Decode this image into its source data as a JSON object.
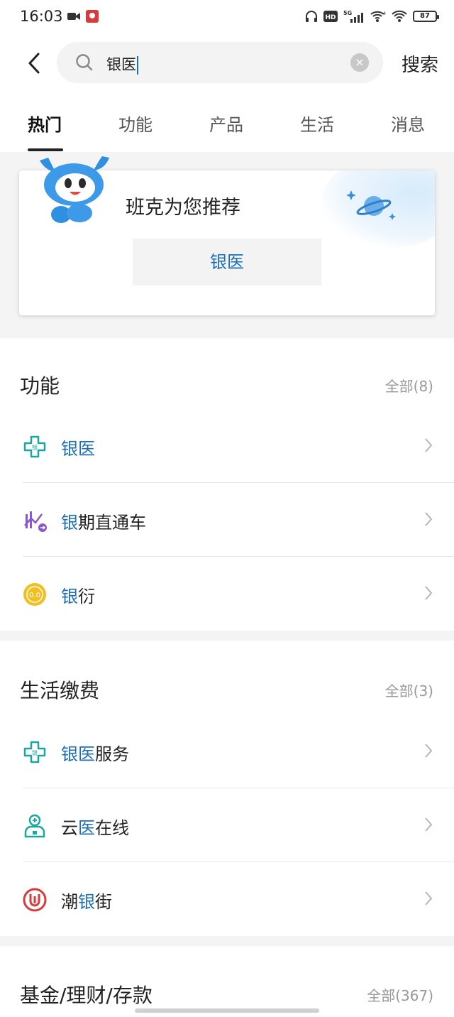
{
  "status_bar": {
    "time": "16:03",
    "battery": "87",
    "network": "5G"
  },
  "search": {
    "query": "银医",
    "button_label": "搜索"
  },
  "tabs": [
    {
      "label": "热门"
    },
    {
      "label": "功能"
    },
    {
      "label": "产品"
    },
    {
      "label": "生活"
    },
    {
      "label": "消息"
    }
  ],
  "recommend": {
    "title": "班克为您推荐",
    "chip": "银医"
  },
  "functions": {
    "title": "功能",
    "all_label": "全部(8)",
    "items": [
      {
        "hl": "银医",
        "rest": ""
      },
      {
        "hl": "银",
        "rest": "期直通车"
      },
      {
        "hl": "银",
        "rest": "衍"
      }
    ]
  },
  "life": {
    "title": "生活缴费",
    "all_label": "全部(3)",
    "items": [
      {
        "pre": "",
        "hl": "银医",
        "rest": "服务"
      },
      {
        "pre": "云",
        "hl": "医",
        "rest": "在线"
      },
      {
        "pre": "潮",
        "hl": "银",
        "rest": "街"
      }
    ]
  },
  "funds": {
    "title": "基金/理财/存款",
    "all_label": "全部(367)"
  },
  "colors": {
    "accent": "#1e6fb3",
    "teal": "#1aa7a0",
    "purple": "#8a58c8",
    "gold": "#f2c01e",
    "red": "#d93a3a"
  }
}
